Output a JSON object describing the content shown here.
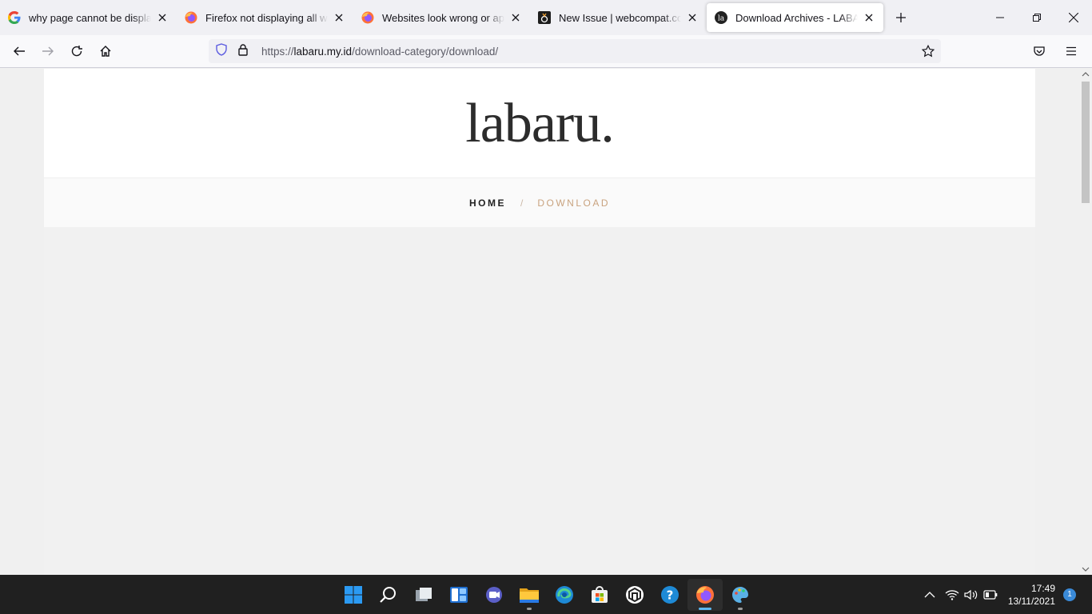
{
  "browser": {
    "tabs": [
      {
        "title": "why page cannot be displayed in",
        "favicon": "google-icon",
        "active": false
      },
      {
        "title": "Firefox not displaying all web pa",
        "favicon": "firefox-icon",
        "active": false
      },
      {
        "title": "Websites look wrong or appear",
        "favicon": "firefox-icon",
        "active": false
      },
      {
        "title": "New Issue | webcompat.com",
        "favicon": "webcompat-icon",
        "active": false
      },
      {
        "title": "Download Archives - LABARU",
        "favicon": "labaru-icon",
        "active": true
      }
    ],
    "url_prefix": "https://",
    "url_host": "labaru.my.id",
    "url_path": "/download-category/download/"
  },
  "page": {
    "logo": "labaru.",
    "breadcrumb": {
      "home": "HOME",
      "separator": "/",
      "current": "DOWNLOAD"
    }
  },
  "taskbar": {
    "apps": [
      "start-icon",
      "search-icon",
      "task-view-icon",
      "widgets-icon",
      "chat-icon",
      "file-explorer-icon",
      "edge-icon",
      "store-icon",
      "app-icon",
      "help-icon",
      "firefox-icon",
      "paint-icon"
    ],
    "time": "17:49",
    "date": "13/11/2021",
    "notifications": "1"
  },
  "colors": {
    "accent": "#c9a37f",
    "taskbar": "#202020",
    "tabstrip": "#f0f0f4"
  }
}
